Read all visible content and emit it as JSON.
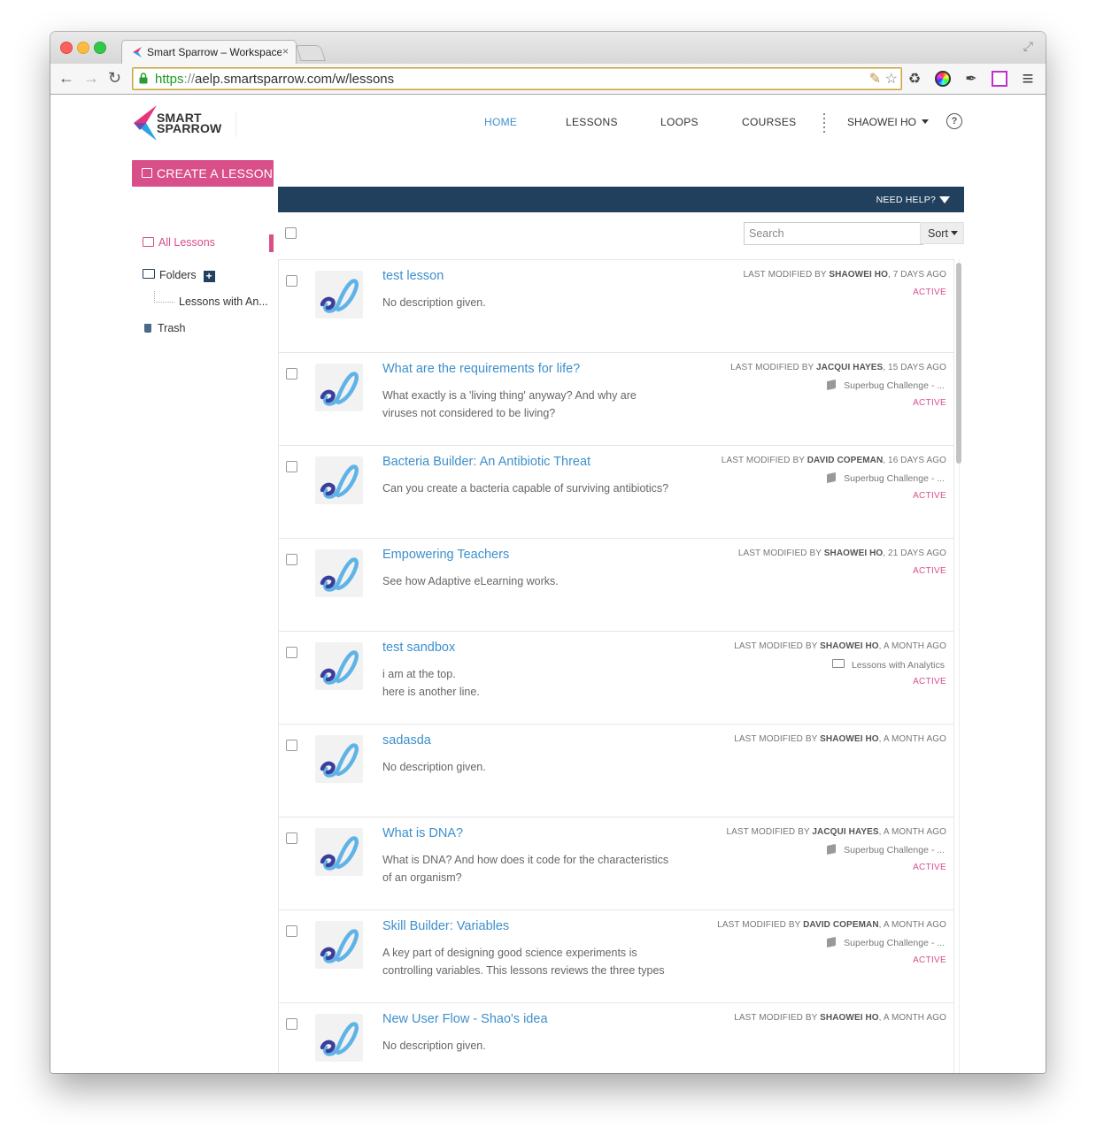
{
  "browser": {
    "tab_title": "Smart Sparrow – Workspace",
    "url_scheme": "https",
    "url_sep": "://",
    "url_rest": "aelp.smartsparrow.com/w/lessons",
    "back_icon": "←",
    "forward_icon": "→",
    "reload_icon": "↻",
    "menu_icon": "≡",
    "star_icon": "☆"
  },
  "app": {
    "logo_line1": "SMART",
    "logo_line2": "SPARROW",
    "brand_colors": {
      "pink": "#d94f8a",
      "blue": "#3d8fcc",
      "navy": "#21405e"
    },
    "nav": [
      {
        "label": "HOME",
        "active": true
      },
      {
        "label": "LESSONS",
        "active": false
      },
      {
        "label": "LOOPS",
        "active": false
      },
      {
        "label": "COURSES",
        "active": false
      }
    ],
    "user": "SHAOWEI HO",
    "help_icon": "?"
  },
  "sidebar": {
    "create_label": "CREATE A LESSON",
    "all_lessons": "All Lessons",
    "folders": "Folders",
    "folder_add": "+",
    "subfolder": "Lessons with An...",
    "trash": "Trash"
  },
  "banner": {
    "need_help": "NEED HELP?"
  },
  "toolbar": {
    "search_placeholder": "Search",
    "sort_label": "Sort"
  },
  "lessons": [
    {
      "title": "test lesson",
      "desc": [
        "No description given."
      ],
      "meta_prefix": "LAST MODIFIED BY ",
      "author": "SHAOWEI HO",
      "when": ", 7 DAYS AGO",
      "location": "",
      "location_type": "",
      "status": "ACTIVE"
    },
    {
      "title": "What are the requirements for life?",
      "desc": [
        "What exactly is a 'living thing' anyway? And why are",
        "viruses not considered to be living?"
      ],
      "meta_prefix": "LAST MODIFIED BY ",
      "author": "JACQUI HAYES",
      "when": ", 15 DAYS AGO",
      "location": "Superbug Challenge - ...",
      "location_type": "course",
      "status": "ACTIVE"
    },
    {
      "title": "Bacteria Builder: An Antibiotic Threat",
      "desc": [
        "Can you create a bacteria capable of surviving antibiotics?"
      ],
      "meta_prefix": "LAST MODIFIED BY ",
      "author": "DAVID COPEMAN",
      "when": ", 16 DAYS AGO",
      "location": "Superbug Challenge - ...",
      "location_type": "course",
      "status": "ACTIVE"
    },
    {
      "title": "Empowering Teachers",
      "desc": [
        "See how Adaptive eLearning works."
      ],
      "meta_prefix": "LAST MODIFIED BY ",
      "author": "SHAOWEI HO",
      "when": ", 21 DAYS AGO",
      "location": "",
      "location_type": "",
      "status": "ACTIVE"
    },
    {
      "title": "test sandbox",
      "desc": [
        "i am at the top.",
        "here is another line."
      ],
      "meta_prefix": "LAST MODIFIED BY ",
      "author": "SHAOWEI HO",
      "when": ", A MONTH AGO",
      "location": "Lessons with Analytics",
      "location_type": "folder",
      "status": "ACTIVE"
    },
    {
      "title": "sadasda",
      "desc": [
        "No description given."
      ],
      "meta_prefix": "LAST MODIFIED BY ",
      "author": "SHAOWEI HO",
      "when": ", A MONTH AGO",
      "location": "",
      "location_type": "",
      "status": ""
    },
    {
      "title": "What is DNA?",
      "desc": [
        "What is DNA? And how does it code for the characteristics",
        "of an organism?"
      ],
      "meta_prefix": "LAST MODIFIED BY ",
      "author": "JACQUI HAYES",
      "when": ", A MONTH AGO",
      "location": "Superbug Challenge - ...",
      "location_type": "course",
      "status": "ACTIVE"
    },
    {
      "title": "Skill Builder: Variables",
      "desc": [
        "A key part of designing good science experiments is",
        "controlling variables. This lessons reviews the three types"
      ],
      "meta_prefix": "LAST MODIFIED BY ",
      "author": "DAVID COPEMAN",
      "when": ", A MONTH AGO",
      "location": "Superbug Challenge - ...",
      "location_type": "course",
      "status": "ACTIVE"
    },
    {
      "title": "New User Flow - Shao's idea",
      "desc": [
        "No description given."
      ],
      "meta_prefix": "LAST MODIFIED BY ",
      "author": "SHAOWEI HO",
      "when": ", A MONTH AGO",
      "location": "",
      "location_type": "",
      "status": ""
    }
  ]
}
